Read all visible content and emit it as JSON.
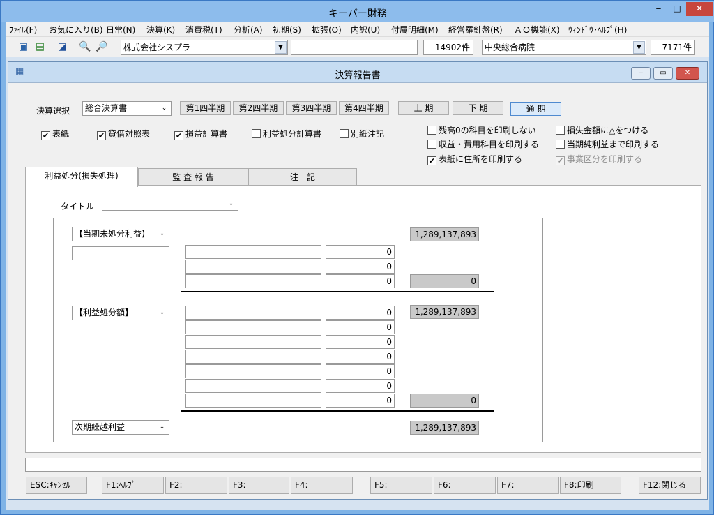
{
  "window": {
    "title": "キーパー財務",
    "minimize": "‒",
    "maximize": "□",
    "close": "✕"
  },
  "menu": [
    "ﾌｧｲﾙ(F)",
    "お気に入り(B)",
    "日常(N)",
    "決算(K)",
    "消費税(T)",
    "分析(A)",
    "初期(S)",
    "拡張(O)",
    "内訳(U)",
    "付属明細(M)",
    "経営羅針盤(R)",
    "ＡＯ機能(X)",
    "ｳｨﾝﾄﾞｳ･ﾍﾙﾌﾟ(H)"
  ],
  "toolbar": {
    "company": "株式会社シスプラ",
    "masked": "",
    "count1": "14902件",
    "client": "中央総合病院",
    "count2": "7171件"
  },
  "report": {
    "title": "決算報告書",
    "select_label": "決算選択",
    "select_value": "総合決算書",
    "quarters": [
      "第1四半期",
      "第2四半期",
      "第3四半期",
      "第4四半期"
    ],
    "periods": [
      "上 期",
      "下 期",
      "通 期"
    ],
    "checks": [
      {
        "label": "表紙",
        "checked": "✔"
      },
      {
        "label": "貸借対照表",
        "checked": "✔"
      },
      {
        "label": "損益計算書",
        "checked": "✔"
      },
      {
        "label": "利益処分計算書",
        "checked": ""
      },
      {
        "label": "別紙注記",
        "checked": ""
      }
    ],
    "options": [
      {
        "label": "残高0の科目を印刷しない",
        "checked": ""
      },
      {
        "label": "収益・費用科目を印刷する",
        "checked": ""
      },
      {
        "label": "表紙に住所を印刷する",
        "checked": "✔"
      },
      {
        "label": "損失金額に△をつける",
        "checked": ""
      },
      {
        "label": "当期純利益まで印刷する",
        "checked": ""
      },
      {
        "label": "事業区分を印刷する",
        "checked": "✔"
      }
    ],
    "tabs": [
      "利益処分(損失処理)",
      "監 査 報 告",
      "注　記"
    ],
    "title_label": "タイトル",
    "title_value": "",
    "sec1": {
      "label": "【当期未処分利益】",
      "total": "1,289,137,893",
      "values": [
        "0",
        "0",
        "0"
      ],
      "subtotal": "0"
    },
    "sec2": {
      "label": "【利益処分額】",
      "total": "1,289,137,893",
      "values": [
        "0",
        "0",
        "0",
        "0",
        "0",
        "0",
        "0"
      ],
      "subtotal": "0"
    },
    "sec3": {
      "label": "次期繰越利益",
      "total": "1,289,137,893"
    }
  },
  "fkeys": [
    "ESC:ｷｬﾝｾﾙ",
    "F1:ﾍﾙﾌﾟ",
    "F2:",
    "F3:",
    "F4:",
    "F5:",
    "F6:",
    "F7:",
    "F8:印刷",
    "F12:閉じる"
  ],
  "status": ""
}
